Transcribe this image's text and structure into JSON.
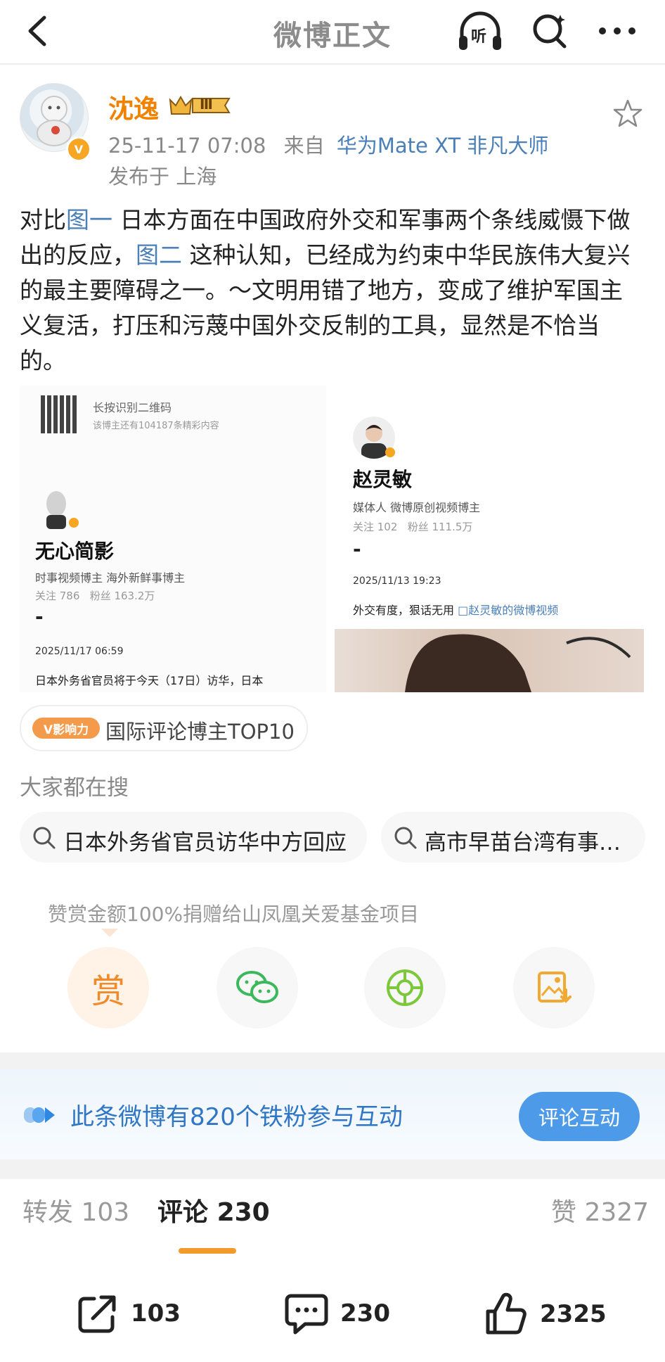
{
  "nav": {
    "title": "微博正文",
    "listen_label": "听"
  },
  "post": {
    "username": "沈逸",
    "level": "Ⅲ",
    "badge": "V",
    "meta_time": "25-11-17 07:08",
    "meta_from": "来自",
    "meta_device": "华为Mate XT 非凡大师",
    "location": "发布于 上海",
    "content": {
      "p1": "对比",
      "link1": "图一",
      "p2": " 日本方面在中国政府外交和军事两个条线威慑下做出的反应，",
      "link2": "图二",
      "p3": " 这种认知，已经成为约束中华民族伟大复兴的最主要障碍之一。～文明用错了地方，变成了维护军国主义复活，打压和污蔑中国外交反制的工具，显然是不恰当的。"
    }
  },
  "image1": {
    "qr_title": "长按识别二维码",
    "qr_sub": "该博主还有104187条精彩内容",
    "name": "无心简影",
    "desc": "时事视频博主 海外新鲜事博主",
    "stats": "关注 786   粉丝 163.2万",
    "dash": "-",
    "time": "2025/11/17 06:59",
    "text": "日本外务省官员将于今天（17日）访华，日本"
  },
  "image2": {
    "name": "赵灵敏",
    "desc": "媒体人 微博原创视频博主",
    "stats": "关注 102   粉丝 111.5万",
    "dash": "-",
    "time": "2025/11/13 19:23",
    "text": "外交有度，狠话无用 ",
    "link": "□赵灵敏的微博视频"
  },
  "tag": {
    "badge": "V影响力",
    "text": "国际评论博主TOP10"
  },
  "search": {
    "title": "大家都在搜",
    "chips": [
      "日本外务省官员访华中方回应",
      "高市早苗台湾有事…"
    ]
  },
  "donate": {
    "text": "赞赏金额100%捐赠给山凤凰关爱基金项目",
    "reward_label": "赏"
  },
  "fans": {
    "text": "此条微博有820个铁粉参与互动",
    "button": "评论互动"
  },
  "tabs": {
    "repost_label": "转发",
    "repost_count": "103",
    "comment_label": "评论",
    "comment_count": "230",
    "like_label": "赞",
    "like_count": "2327"
  },
  "bottom": {
    "repost": "103",
    "comment": "230",
    "like": "2325"
  },
  "colors": {
    "orange": "#f08200",
    "link": "#4a7fb8",
    "blue": "#4c9ae8"
  }
}
